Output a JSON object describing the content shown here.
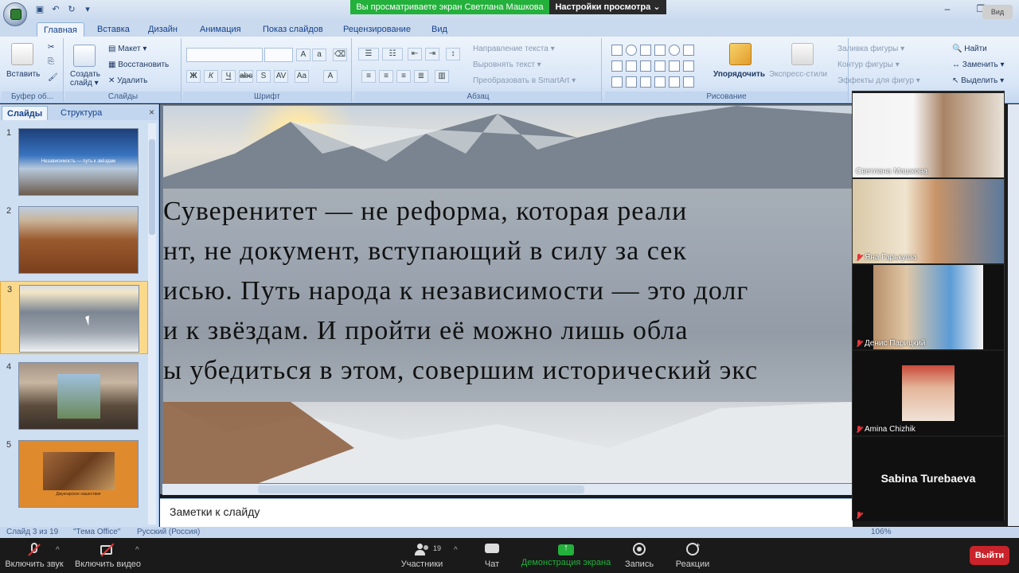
{
  "share_banner": {
    "status": "Вы просматриваете экран Светлана Машкова",
    "options": "Настройки просмотра ⌄"
  },
  "view_button": "Вид",
  "ribbon": {
    "tabs": [
      "Главная",
      "Вставка",
      "Дизайн",
      "Анимация",
      "Показ слайдов",
      "Рецензирование",
      "Вид"
    ],
    "clipboard": {
      "paste": "Вставить",
      "label": "Буфер об..."
    },
    "slides": {
      "new_slide": "Создать слайд ▾",
      "layout": "Макет ▾",
      "reset": "Восстановить",
      "delete": "Удалить",
      "label": "Слайды"
    },
    "font": {
      "label": "Шрифт"
    },
    "paragraph": {
      "text_direction": "Направление текста ▾",
      "align_text": "Выровнять текст ▾",
      "smartart": "Преобразовать в SmartArt ▾",
      "label": "Абзац"
    },
    "drawing": {
      "arrange": "Упорядочить",
      "quick_styles": "Экспресс-стили",
      "fill": "Заливка фигуры ▾",
      "outline": "Контур фигуры ▾",
      "effects": "Эффекты для фигур ▾",
      "label": "Рисование"
    },
    "editing": {
      "find": "Найти",
      "replace": "Заменить ▾",
      "select": "Выделить ▾"
    }
  },
  "slides_pane": {
    "tab_slides": "Слайды",
    "tab_outline": "Структура",
    "close": "×",
    "thumbs": [
      {
        "num": "1",
        "caption": "Независимость — путь к звёздам"
      },
      {
        "num": "2",
        "caption": ""
      },
      {
        "num": "3",
        "caption": ""
      },
      {
        "num": "4",
        "caption": ""
      },
      {
        "num": "5",
        "caption": "Джунгарское нашествие"
      }
    ]
  },
  "slide": {
    "lines": [
      "Суверенитет  —  не  реформа,  которая  реали",
      "нт,  не  документ,  вступающий  в  силу  за  сек",
      "исью. Путь народа к независимости — это долг",
      "и  к  звёздам.  И  пройти  её  можно  лишь  обла",
      "ы убедиться в этом, совершим исторический экс"
    ]
  },
  "notes_placeholder": "Заметки к слайду",
  "statusbar": {
    "slide_info": "Слайд 3 из 19",
    "theme": "\"Тема Office\"",
    "language": "Русский (Россия)",
    "zoom": "106%"
  },
  "participants_video": [
    {
      "name": "Светлана Машкова",
      "muted": false
    },
    {
      "name": "Яна Гарькуша",
      "muted": true
    },
    {
      "name": "Денис Парицкий",
      "muted": true
    },
    {
      "name": "Amina Chizhik",
      "muted": true
    },
    {
      "name": "Sabina Turebaeva",
      "muted": true
    }
  ],
  "zoom_toolbar": {
    "unmute": "Включить звук",
    "start_video": "Включить видео",
    "participants": "Участники",
    "participants_count": "19",
    "chat": "Чат",
    "share_screen": "Демонстрация экрана",
    "record": "Запись",
    "reactions": "Реакции",
    "leave": "Выйти"
  },
  "colors": {
    "share_green": "#23b03b",
    "leave_red": "#c9232b",
    "ribbon_blue": "#d8e6f7",
    "selection_orange": "#fbd98a"
  }
}
